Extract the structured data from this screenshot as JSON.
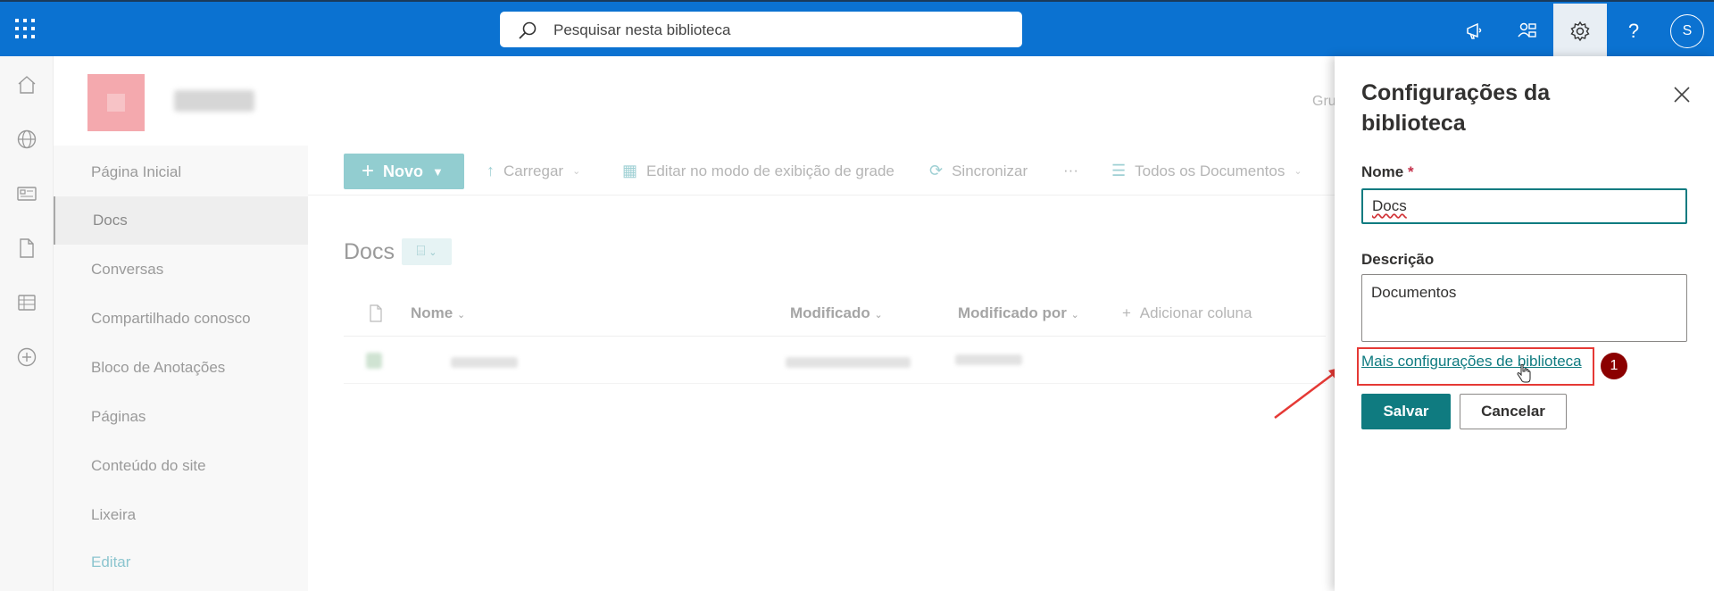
{
  "topbar": {
    "search_placeholder": "Pesquisar nesta biblioteca",
    "avatar_initial": "S",
    "help_glyph": "?"
  },
  "site": {
    "group_text": "Gru"
  },
  "leftnav": {
    "items": [
      {
        "label": "Página Inicial"
      },
      {
        "label": "Docs"
      },
      {
        "label": "Conversas"
      },
      {
        "label": "Compartilhado conosco"
      },
      {
        "label": "Bloco de Anotações"
      },
      {
        "label": "Páginas"
      },
      {
        "label": "Conteúdo do site"
      },
      {
        "label": "Lixeira"
      },
      {
        "label": "Editar"
      }
    ],
    "selected_index": 1
  },
  "commandbar": {
    "new_label": "Novo",
    "upload_label": "Carregar",
    "grid_label": "Editar no modo de exibição de grade",
    "sync_label": "Sincronizar",
    "more_label": "···",
    "view_label": "Todos os Documentos"
  },
  "library": {
    "title": "Docs",
    "columns": {
      "name": "Nome",
      "modified": "Modificado",
      "modified_by": "Modificado por",
      "add_column": "Adicionar coluna"
    }
  },
  "panel": {
    "title": "Configurações da biblioteca",
    "name_label": "Nome",
    "required_mark": "*",
    "name_value": "Docs",
    "description_label": "Descrição",
    "description_value": "Documentos",
    "more_settings_link": "Mais configurações de biblioteca",
    "step_badge": "1",
    "save_label": "Salvar",
    "cancel_label": "Cancelar"
  },
  "colors": {
    "suite_bar": "#0b72d1",
    "theme": "#0f7b80",
    "highlight": "#e53935",
    "badge": "#8b0000"
  }
}
